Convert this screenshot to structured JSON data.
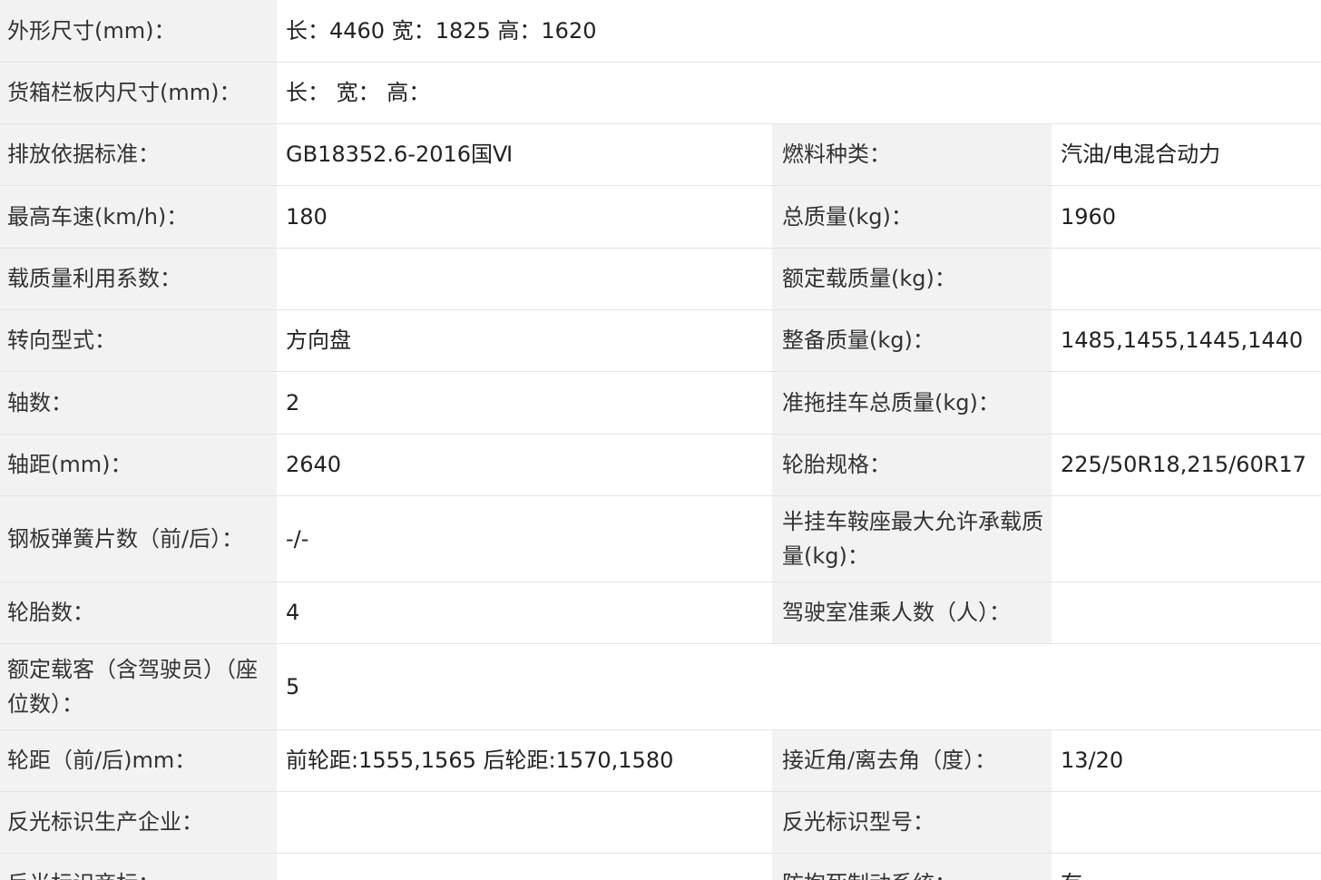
{
  "rows": [
    {
      "label": "外形尺寸(mm)：",
      "value": "长：4460 宽：1825 高：1620"
    },
    {
      "label": "货箱栏板内尺寸(mm)：",
      "value": "长：  宽：  高："
    },
    {
      "label": "排放依据标准：",
      "value": "GB18352.6-2016国Ⅵ",
      "label2": "燃料种类：",
      "value2": "汽油/电混合动力"
    },
    {
      "label": "最高车速(km/h)：",
      "value": "180",
      "label2": "总质量(kg)：",
      "value2": "1960"
    },
    {
      "label": "载质量利用系数：",
      "value": "",
      "label2": "额定载质量(kg)：",
      "value2": ""
    },
    {
      "label": "转向型式：",
      "value": "方向盘",
      "label2": "整备质量(kg)：",
      "value2": "1485,1455,1445,1440"
    },
    {
      "label": "轴数：",
      "value": "2",
      "label2": "准拖挂车总质量(kg)：",
      "value2": ""
    },
    {
      "label": "轴距(mm)：",
      "value": "2640",
      "label2": "轮胎规格：",
      "value2": "225/50R18,215/60R17"
    },
    {
      "label": "钢板弹簧片数（前/后）：",
      "value": "-/-",
      "label2": "半挂车鞍座最大允许承载质量(kg)：",
      "value2": ""
    },
    {
      "label": "轮胎数：",
      "value": "4",
      "label2": "驾驶室准乘人数（人）：",
      "value2": ""
    },
    {
      "label": "额定载客（含驾驶员）（座位数）：",
      "value": "5"
    },
    {
      "label": "轮距（前/后)mm：",
      "value": "前轮距:1555,1565 后轮距:1570,1580",
      "label2": "接近角/离去角（度）：",
      "value2": "13/20"
    },
    {
      "label": "反光标识生产企业：",
      "value": "",
      "label2": "反光标识型号：",
      "value2": ""
    },
    {
      "label": "反光标识商标：",
      "value": "",
      "label2": "防抱死制动系统：",
      "value2": "有"
    }
  ]
}
